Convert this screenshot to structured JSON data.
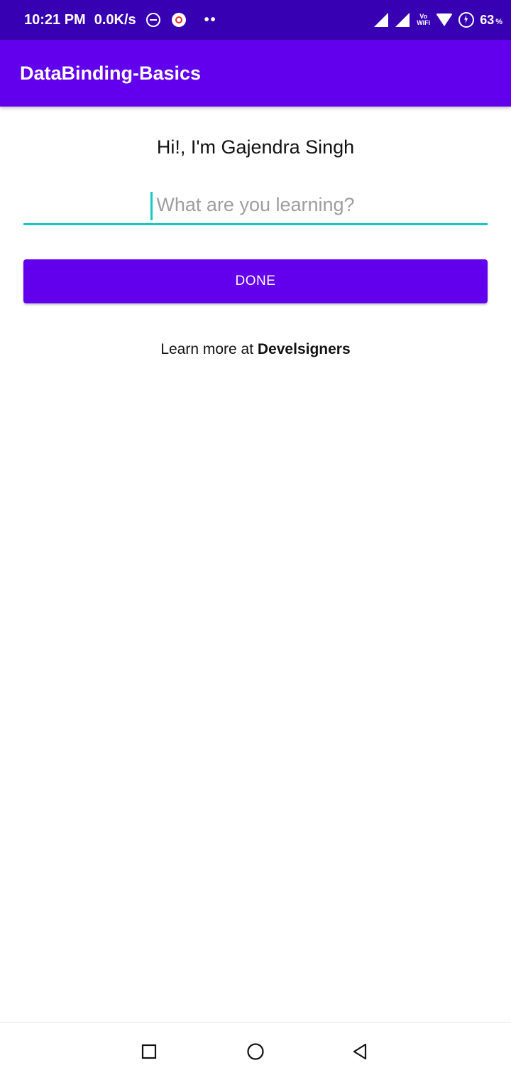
{
  "status_bar": {
    "time": "10:21 PM",
    "net_speed": "0.0K/s",
    "more_indicator": "••",
    "vowifi_top": "Vo",
    "vowifi_bottom": "WiFi",
    "battery_percent": "63",
    "battery_unit": "%"
  },
  "app_bar": {
    "title": "DataBinding-Basics"
  },
  "main": {
    "greeting": "Hi!, I'm Gajendra Singh",
    "input": {
      "value": "",
      "placeholder": "What are you learning?"
    },
    "done_label": "DONE",
    "footer_prefix": "Learn more at ",
    "footer_link": "Develsigners"
  },
  "navigation_bar": {
    "icons": [
      "recents-square-icon",
      "home-circle-icon",
      "back-triangle-icon"
    ]
  },
  "colors": {
    "status_bar": "#3700b3",
    "primary": "#6200ee",
    "accent": "#14c8c0",
    "placeholder": "#9e9e9e"
  }
}
